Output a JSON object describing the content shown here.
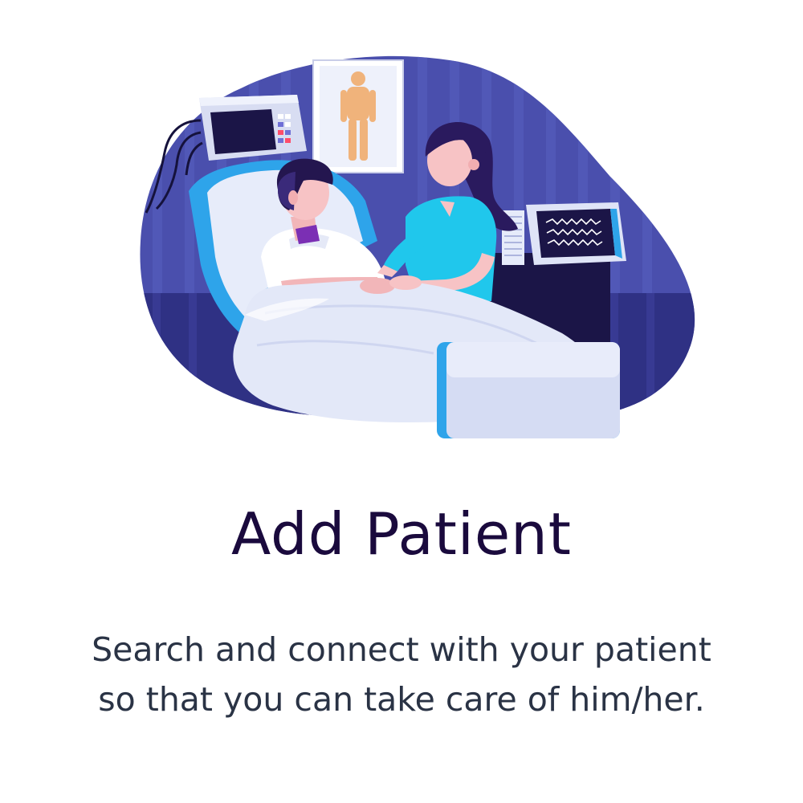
{
  "onboarding": {
    "title": "Add Patient",
    "description_line_1": "Search and connect with your patient",
    "description_line_2": "so that you can take care of him/her.",
    "illustration": "nurse-caring-for-patient-in-hospital-bed"
  },
  "colors": {
    "background": "#ffffff",
    "title": "#1a0a3d",
    "body_text": "#2a3345",
    "blob_dark": "#3c3f9a",
    "blob_mid": "#5861c0",
    "accent_blue": "#2ea4ea",
    "scrubs": "#20c7ec",
    "sheet": "#e6ecfa"
  }
}
